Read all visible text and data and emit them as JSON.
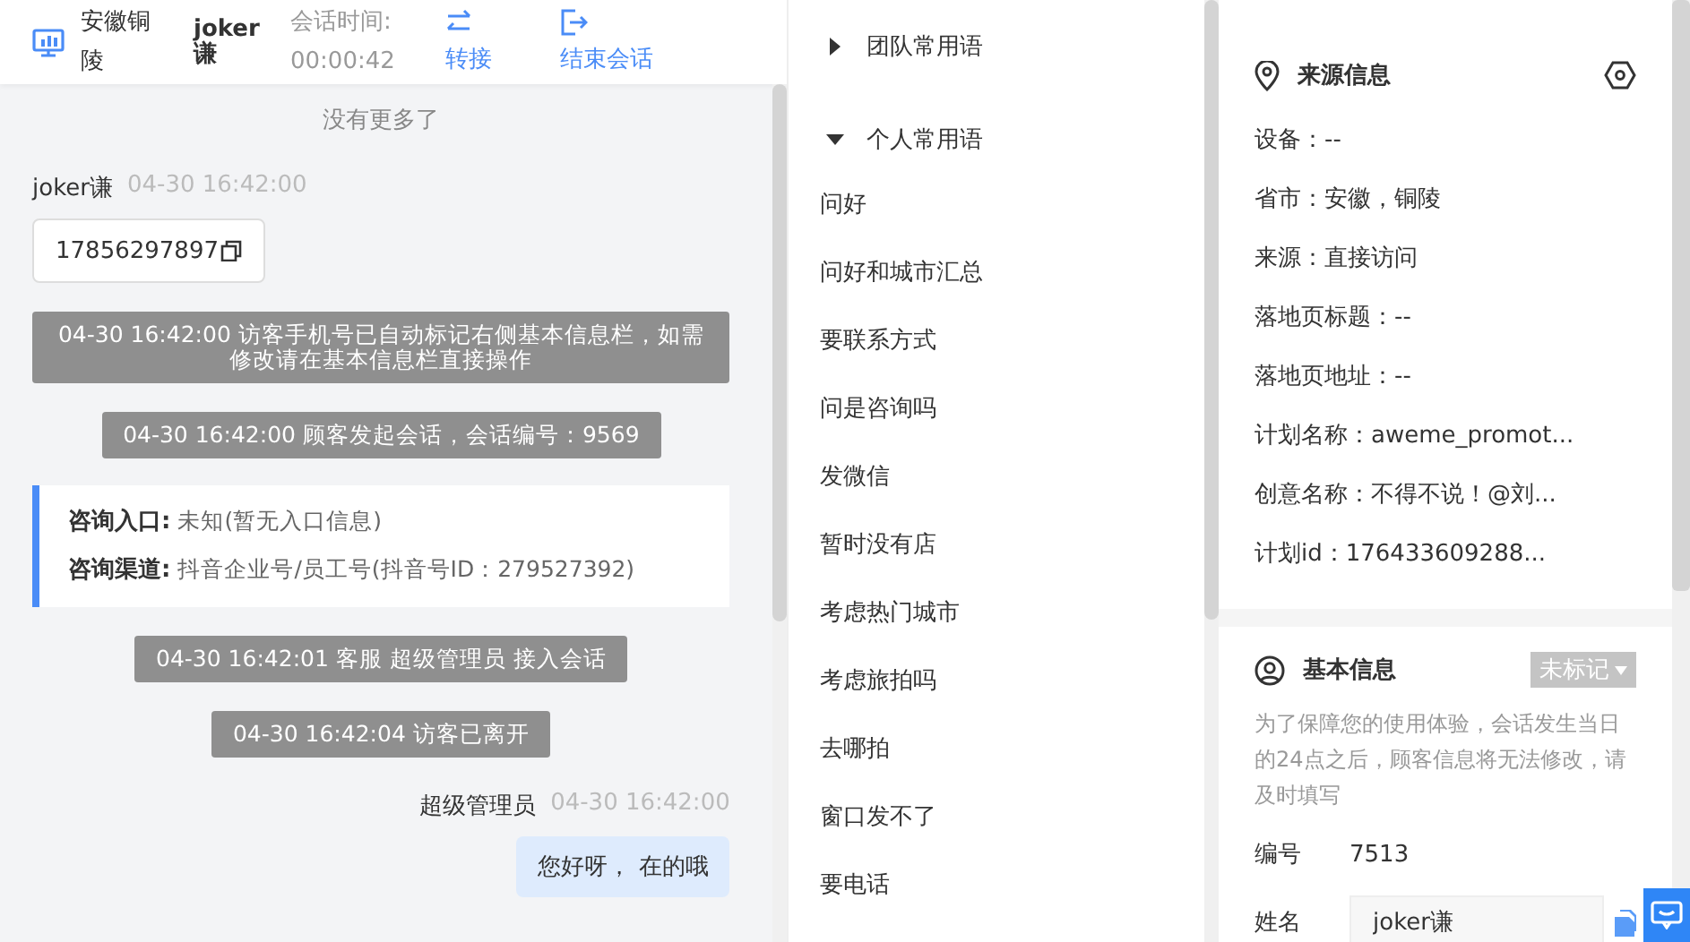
{
  "header": {
    "location": "安徽铜陵",
    "visitor_name": "joker谦",
    "session_time_label": "会话时间:",
    "session_time": "00:00:42",
    "actions": [
      {
        "kind": "transfer",
        "label": "转接"
      },
      {
        "kind": "end",
        "label": "结束会话"
      }
    ]
  },
  "chat": {
    "messages": [
      {
        "kind": "notice",
        "text": "没有更多了"
      },
      {
        "kind": "visitor",
        "name": "joker谦",
        "time": "04-30 16:42:00",
        "text": "17856297897"
      },
      {
        "kind": "system",
        "text": "04-30 16:42:00 访客手机号已自动标记右侧基本信息栏，如需修改请在基本信息栏直接操作"
      },
      {
        "kind": "system",
        "text": "04-30 16:42:00 顾客发起会话，会话编号：9569"
      },
      {
        "kind": "info_card",
        "rows": [
          {
            "label": "咨询入口:",
            "value": "未知(暂无入口信息)"
          },
          {
            "label": "咨询渠道:",
            "value": "抖音企业号/员工号(抖音号ID：279527392)"
          }
        ]
      },
      {
        "kind": "system",
        "text": "04-30 16:42:01 客服 超级管理员 接入会话"
      },
      {
        "kind": "system",
        "text": "04-30 16:42:04 访客已离开"
      },
      {
        "kind": "agent",
        "name": "超级管理员",
        "time": "04-30 16:42:00",
        "text": "您好呀， 在的哦"
      }
    ]
  },
  "phrases": {
    "groups": [
      {
        "label": "团队常用语",
        "expanded": false
      },
      {
        "label": "个人常用语",
        "expanded": true,
        "children": [
          "问好",
          "问好和城市汇总",
          "要联系方式",
          "问是咨询吗",
          "发微信",
          "暂时没有店",
          "考虑热门城市",
          "考虑旅拍吗",
          "去哪拍",
          "窗口发不了",
          "要电话"
        ]
      }
    ]
  },
  "source_info": {
    "title": "来源信息",
    "rows": [
      "设备：--",
      "省市：安徽，铜陵",
      "来源：直接访问",
      "落地页标题：--",
      "落地页地址：--",
      "计划名称：aweme_promot...",
      "创意名称：不得不说！@刘...",
      "计划id：176433609288..."
    ]
  },
  "basic_info": {
    "title": "基本信息",
    "tag": "未标记",
    "note": "为了保障您的使用体验，会话发生当日的24点之后，顾客信息将无法修改，请及时填写",
    "fields": [
      {
        "kind": "text",
        "label": "编号",
        "value": "7513"
      },
      {
        "kind": "input",
        "label": "姓名",
        "value": "joker谦"
      }
    ]
  }
}
